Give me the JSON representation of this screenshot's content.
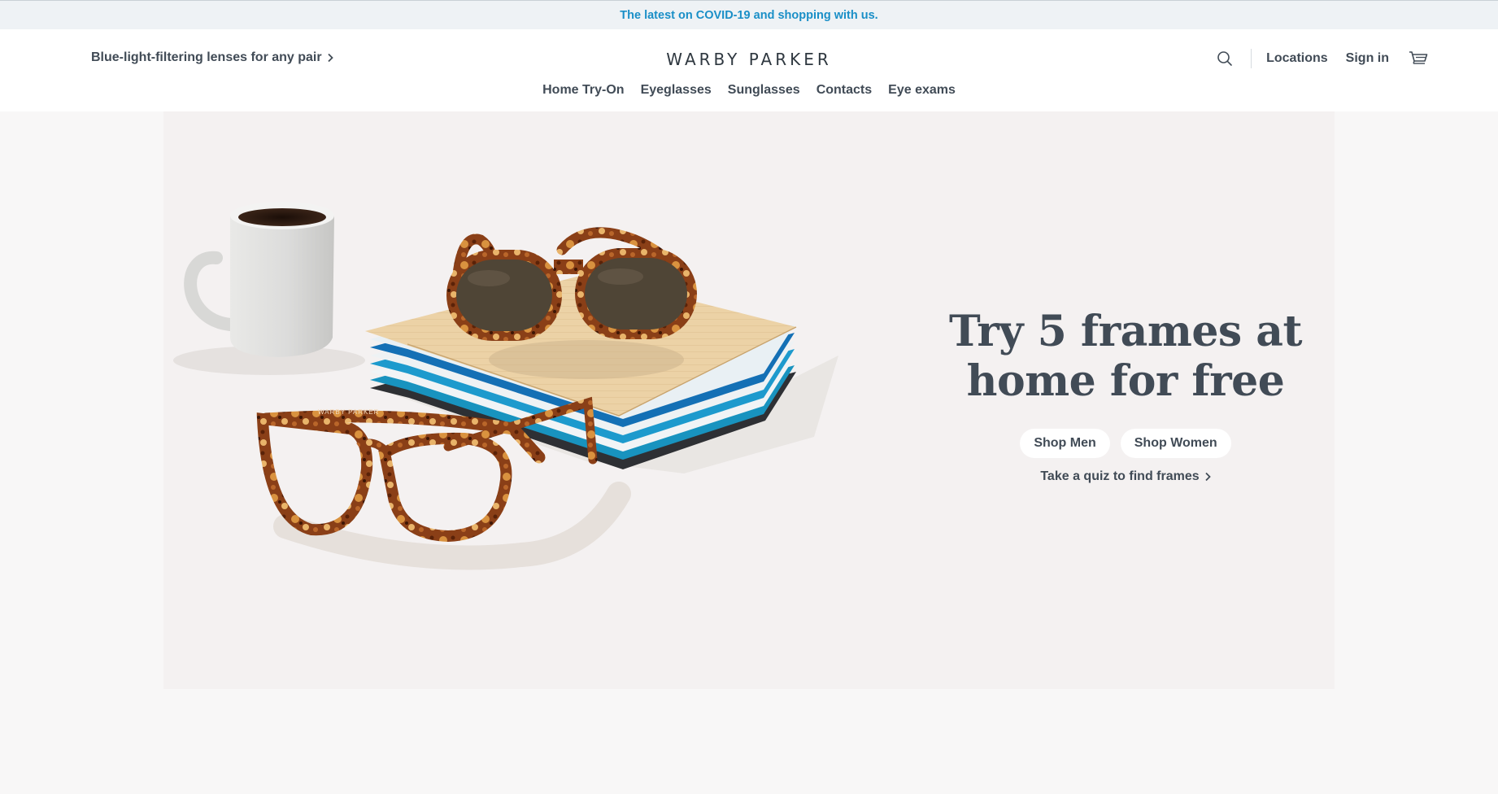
{
  "announcement": {
    "text": "The latest on COVID-19 and shopping with us."
  },
  "header": {
    "promo_text": "Blue-light-filtering lenses for any pair",
    "brand": "WARBY PARKER",
    "locations_label": "Locations",
    "signin_label": "Sign in"
  },
  "nav": {
    "items": [
      {
        "label": "Home Try-On"
      },
      {
        "label": "Eyeglasses"
      },
      {
        "label": "Sunglasses"
      },
      {
        "label": "Contacts"
      },
      {
        "label": "Eye exams"
      }
    ]
  },
  "hero": {
    "title_line1": "Try 5 frames at",
    "title_line2": "home for free",
    "shop_men": "Shop Men",
    "shop_women": "Shop Women",
    "quiz_link": "Take a quiz to find frames",
    "glasses_temple_print": "WARBY PARKER"
  },
  "colors": {
    "announcement_link": "#1a8fc7",
    "text": "#414b56",
    "hero_bg": "#f4f1f1"
  },
  "icons": [
    "chevron-right-icon",
    "search-icon",
    "cart-icon"
  ]
}
